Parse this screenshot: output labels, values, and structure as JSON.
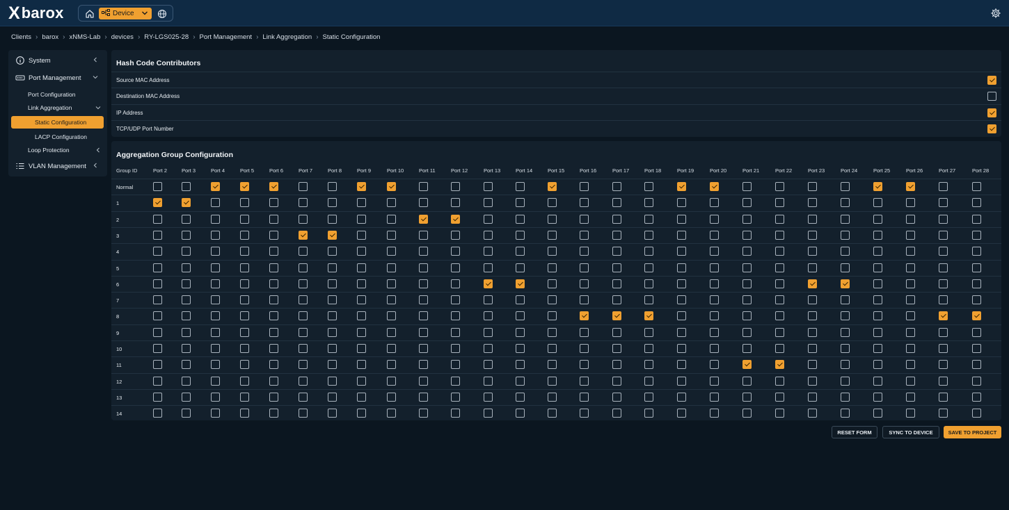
{
  "app": {
    "logo_mark": "X",
    "logo_text": "barox",
    "device_label": "Device"
  },
  "icons": {
    "home": "home-icon",
    "device": "network-icon",
    "globe": "globe-icon",
    "settings": "gear-icon"
  },
  "colors": {
    "accent": "#f0a030",
    "topbar": "#0f2a44",
    "background": "#0b1620",
    "panel": "#13202c"
  },
  "breadcrumb": [
    "Clients",
    "barox",
    "xNMS-Lab",
    "devices",
    "RY-LGS025-28",
    "Port Management",
    "Link Aggregation",
    "Static Configuration"
  ],
  "sidebar": {
    "system": "System",
    "port_management": "Port Management",
    "port_configuration": "Port Configuration",
    "link_aggregation": "Link Aggregation",
    "static_configuration": "Static Configuration",
    "lacp_configuration": "LACP Configuration",
    "loop_protection": "Loop Protection",
    "vlan_management": "VLAN Management"
  },
  "hash": {
    "title": "Hash Code Contributors",
    "rows": [
      {
        "label": "Source MAC Address",
        "checked": true
      },
      {
        "label": "Destination MAC Address",
        "checked": false
      },
      {
        "label": "IP Address",
        "checked": true
      },
      {
        "label": "TCP/UDP Port Number",
        "checked": true
      }
    ]
  },
  "aggregation": {
    "title": "Aggregation Group Configuration",
    "group_header": "Group ID",
    "ports": [
      "Port 2",
      "Port 3",
      "Port 4",
      "Port 5",
      "Port 6",
      "Port 7",
      "Port 8",
      "Port 9",
      "Port 10",
      "Port 11",
      "Port 12",
      "Port 13",
      "Port 14",
      "Port 15",
      "Port 16",
      "Port 17",
      "Port 18",
      "Port 19",
      "Port 20",
      "Port 21",
      "Port 22",
      "Port 23",
      "Port 24",
      "Port 25",
      "Port 26",
      "Port 27",
      "Port 28"
    ],
    "groups": [
      {
        "id": "Normal",
        "checked": [
          "Port 4",
          "Port 5",
          "Port 6",
          "Port 9",
          "Port 10",
          "Port 15",
          "Port 19",
          "Port 20",
          "Port 25",
          "Port 26"
        ]
      },
      {
        "id": "1",
        "checked": [
          "Port 2",
          "Port 3"
        ]
      },
      {
        "id": "2",
        "checked": [
          "Port 11",
          "Port 12"
        ]
      },
      {
        "id": "3",
        "checked": [
          "Port 7",
          "Port 8"
        ]
      },
      {
        "id": "4",
        "checked": []
      },
      {
        "id": "5",
        "checked": []
      },
      {
        "id": "6",
        "checked": [
          "Port 13",
          "Port 14",
          "Port 23",
          "Port 24"
        ]
      },
      {
        "id": "7",
        "checked": []
      },
      {
        "id": "8",
        "checked": [
          "Port 16",
          "Port 17",
          "Port 18",
          "Port 27",
          "Port 28"
        ]
      },
      {
        "id": "9",
        "checked": []
      },
      {
        "id": "10",
        "checked": []
      },
      {
        "id": "11",
        "checked": [
          "Port 21",
          "Port 22"
        ]
      },
      {
        "id": "12",
        "checked": []
      },
      {
        "id": "13",
        "checked": []
      },
      {
        "id": "14",
        "checked": []
      }
    ]
  },
  "actions": {
    "reset": "RESET FORM",
    "sync": "SYNC TO DEVICE",
    "save": "SAVE TO PROJECT"
  }
}
